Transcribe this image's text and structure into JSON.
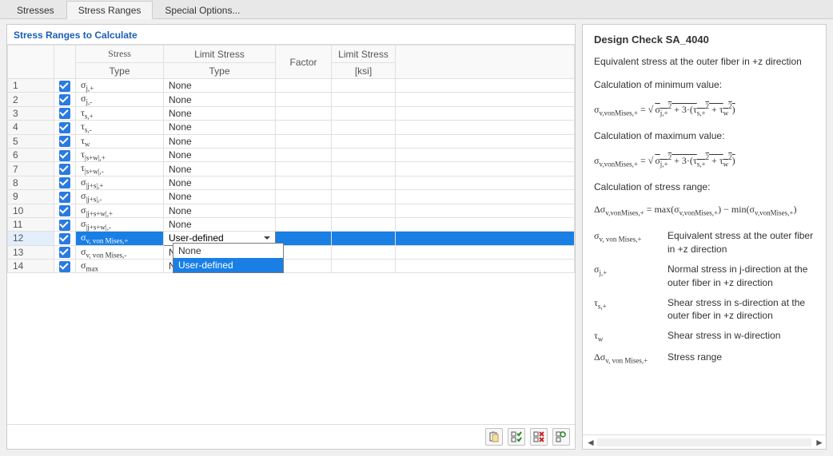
{
  "tabs": {
    "stresses": "Stresses",
    "stress_ranges": "Stress Ranges",
    "special_options": "Special Options..."
  },
  "caption": "Stress Ranges to Calculate",
  "headers": {
    "stress_type": "Stress",
    "stress_type2": "Type",
    "limit_type": "Limit Stress",
    "limit_type2": "Type",
    "factor": "Factor",
    "limit_ksi": "Limit Stress",
    "limit_ksi2": "[ksi]"
  },
  "rows": [
    {
      "n": "1",
      "stype": "σ<sub>j,+</sub>",
      "limit": "None"
    },
    {
      "n": "2",
      "stype": "σ<sub>j,-</sub>",
      "limit": "None"
    },
    {
      "n": "3",
      "stype": "τ<sub>s,+</sub>",
      "limit": "None"
    },
    {
      "n": "4",
      "stype": "τ<sub>s,-</sub>",
      "limit": "None"
    },
    {
      "n": "5",
      "stype": "τ<sub>w</sub>",
      "limit": "None"
    },
    {
      "n": "6",
      "stype": "τ<sub>|s+w|,+</sub>",
      "limit": "None"
    },
    {
      "n": "7",
      "stype": "τ<sub>|s+w|,-</sub>",
      "limit": "None"
    },
    {
      "n": "8",
      "stype": "σ<sub>|j+s|,+</sub>",
      "limit": "None"
    },
    {
      "n": "9",
      "stype": "σ<sub>|j+s|,-</sub>",
      "limit": "None"
    },
    {
      "n": "10",
      "stype": "σ<sub>|j+s+w|,+</sub>",
      "limit": "None"
    },
    {
      "n": "11",
      "stype": "σ<sub>|j+s+w|,-</sub>",
      "limit": "None"
    },
    {
      "n": "12",
      "stype": "σ<sub>v, von Mises,+</sub>",
      "limit": "User-defined",
      "selected": true,
      "dropdown": true
    },
    {
      "n": "13",
      "stype": "σ<sub>v, von Mises,-</sub>",
      "limit": "None"
    },
    {
      "n": "14",
      "stype": "σ<sub>max</sub>",
      "limit": "None"
    }
  ],
  "dropdown_options": {
    "opt1": "None",
    "opt2": "User-defined"
  },
  "toolbar": {
    "paste": "📋",
    "checkall": "✓",
    "uncheckall": "✗",
    "reset": "↺"
  },
  "panel": {
    "title": "Design Check SA_4040",
    "subtitle": "Equivalent stress at the outer fiber in +z direction",
    "min_label": "Calculation of minimum value:",
    "max_label": "Calculation of maximum value:",
    "range_label": "Calculation of stress range:",
    "formula_min": "σ<sub>v,vonMises,+</sub> = √<span class='sqrt'>σ<sub>j,+</sub><sup>2</sup> + 3·(τ<sub>s,+</sub><sup>2</sup> + τ<sub>w</sub><sup>2</sup>)</span>",
    "formula_max": "σ<sub>v,vonMises,+</sub> = √<span class='sqrt'>σ<sub>j,+</sub><sup>2</sup> + 3·(τ<sub>s,+</sub><sup>2</sup> + τ<sub>w</sub><sup>2</sup>)</span>",
    "formula_range": "Δσ<sub>v,vonMises,+</sub> = max(σ<sub>v,vonMises,+</sub>) − min(σ<sub>v,vonMises,+</sub>)",
    "legend": [
      {
        "sym": "σ<sub>v, von Mises,+</sub>",
        "desc": "Equivalent stress at the outer fiber in +z direction"
      },
      {
        "sym": "σ<sub>j,+</sub>",
        "desc": "Normal stress in j-direction at the outer fiber in +z direction"
      },
      {
        "sym": "τ<sub>s,+</sub>",
        "desc": "Shear stress in s-direction at the outer fiber in +z direction"
      },
      {
        "sym": "τ<sub>w</sub>",
        "desc": "Shear stress in w-direction"
      },
      {
        "sym": "Δσ<sub>v, von Mises,+</sub>",
        "desc": "Stress range"
      }
    ]
  }
}
